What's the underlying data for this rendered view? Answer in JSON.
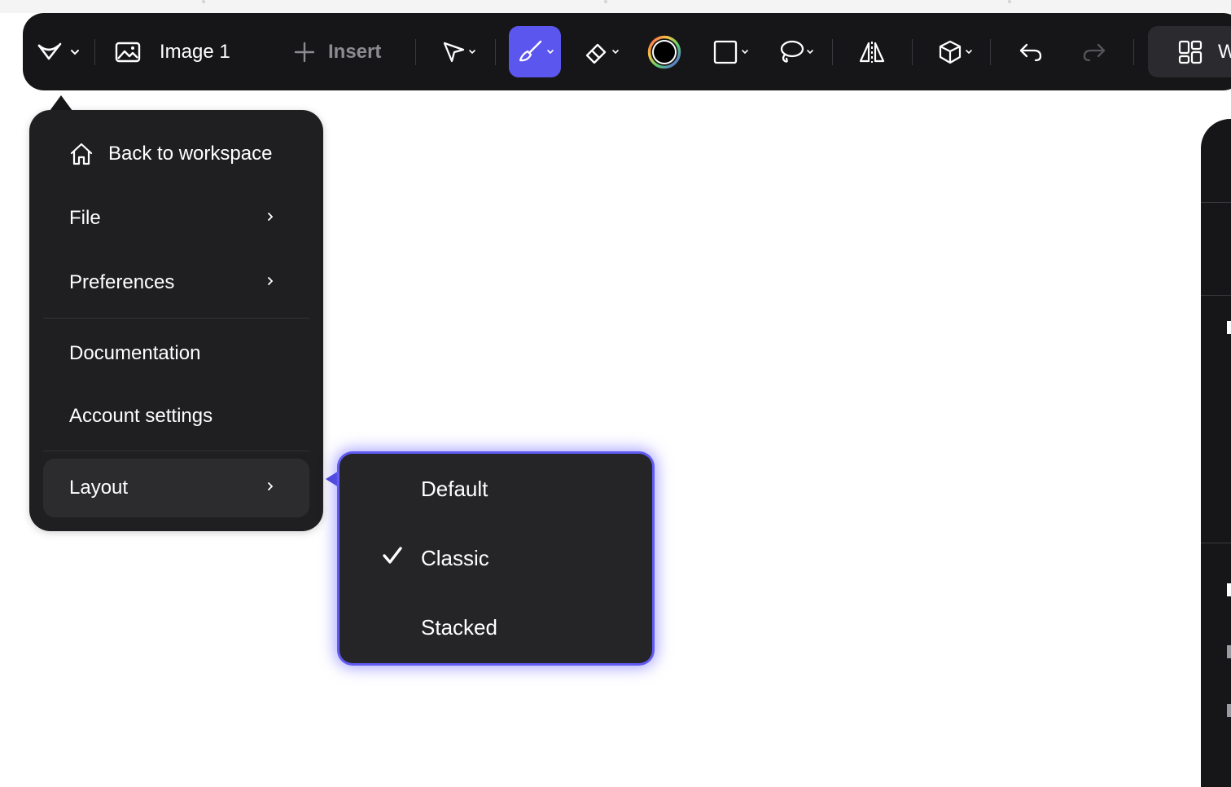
{
  "toolbar": {
    "document_title": "Image 1",
    "insert_label": "Insert",
    "right_label": "W",
    "accent_color": "#5b57ee",
    "icons": [
      "app-logo-icon",
      "chevron-down-icon",
      "image-icon",
      "plus-icon",
      "select-arrow-icon",
      "brush-icon",
      "eraser-icon",
      "color-swatch-icon",
      "rectangle-icon",
      "lasso-icon",
      "flip-icon",
      "3d-box-icon",
      "undo-icon",
      "redo-icon",
      "layout-grid-icon"
    ]
  },
  "main_menu": {
    "items": [
      {
        "label": "Back to workspace",
        "icon": "home-icon"
      },
      {
        "label": "File",
        "has_submenu": true
      },
      {
        "label": "Preferences",
        "has_submenu": true
      },
      {
        "label": "Documentation"
      },
      {
        "label": "Account settings"
      },
      {
        "label": "Layout",
        "has_submenu": true,
        "active": true
      }
    ]
  },
  "layout_submenu": {
    "items": [
      {
        "label": "Default",
        "checked": false
      },
      {
        "label": "Classic",
        "checked": true
      },
      {
        "label": "Stacked",
        "checked": false
      }
    ]
  }
}
